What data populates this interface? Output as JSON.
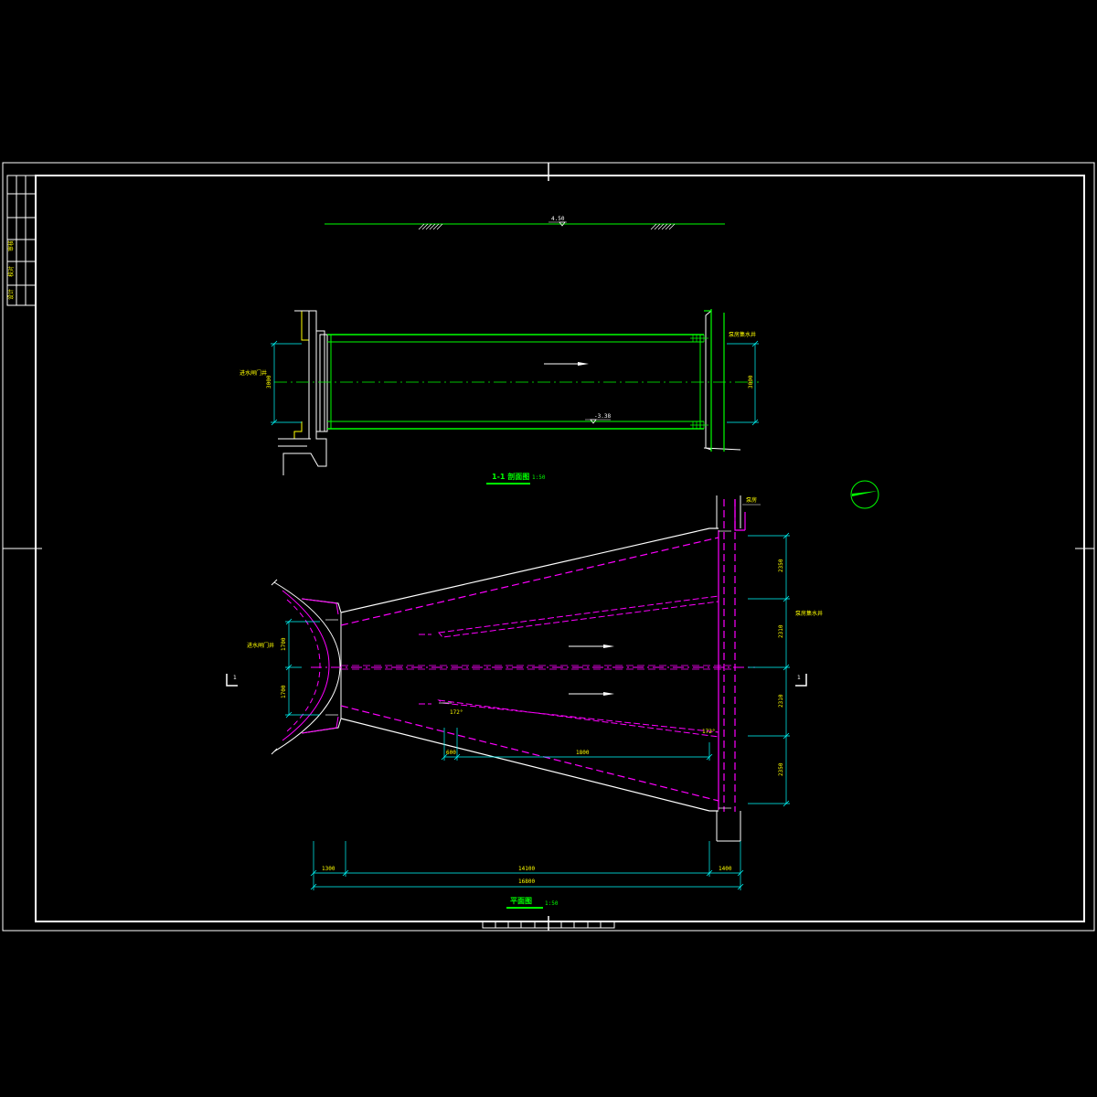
{
  "colors": {
    "background": "#000000",
    "frame": "#ffffff",
    "section_outline": "#00ff00",
    "centerline": "#00ff00",
    "plan_dashed": "#ff00ff",
    "dimension": "#00ffff",
    "text": "#ffff00"
  },
  "section": {
    "title": "1-1 剖面图",
    "scale": "1:50",
    "ground_level": "4.50",
    "bottom_level": "-3.38",
    "left_label": "进水闸门井",
    "right_label": "泵房集水井",
    "height_left": "3000",
    "height_right": "3000"
  },
  "plan": {
    "title": "平面图",
    "scale": "1:50",
    "left_label": "进水闸门井",
    "right_label": "泵房集水井",
    "left_dims": [
      "1700",
      "1700"
    ],
    "right_dims": [
      "2350",
      "2310",
      "2310",
      "2350"
    ],
    "bottom_dims": [
      "1300",
      "14100",
      "1400"
    ],
    "total_dim": "16800",
    "inner_dims": [
      "600",
      "1800"
    ],
    "angle_1": "172°",
    "angle_2": "172°",
    "section_mark": "1",
    "top_note": "泵房"
  },
  "title_block_left": [
    "审核",
    "校对",
    "设计"
  ]
}
